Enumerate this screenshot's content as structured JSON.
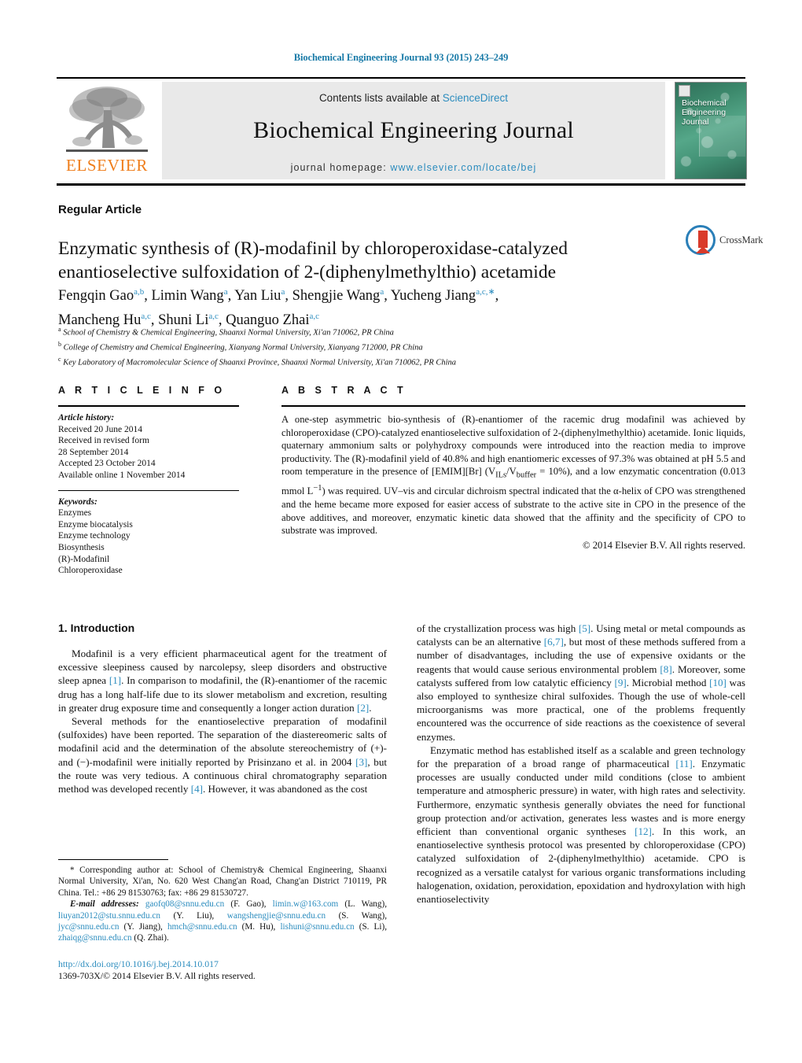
{
  "running_head": "Biochemical Engineering Journal 93 (2015) 243–249",
  "masthead": {
    "contents_prefix": "Contents lists available at ",
    "contents_link": "ScienceDirect",
    "journal_title": "Biochemical Engineering Journal",
    "homepage_label": "journal homepage:",
    "homepage_url": "www.elsevier.com/locate/bej",
    "publisher": "ELSEVIER",
    "cover_title_lines": [
      "Biochemical",
      "Engineering",
      "Journal"
    ],
    "link_color": "#2b8cbe",
    "publisher_color": "#ef7d1a"
  },
  "article": {
    "kind": "Regular Article",
    "title_line1": "Enzymatic synthesis of (R)-modafinil by chloroperoxidase-catalyzed",
    "title_line2": "enantioselective sulfoxidation of 2-(diphenylmethylthio) acetamide",
    "crossmark_label": "CrossMark",
    "authors_line1": "Fengqin Gao<sup>a,b</sup>, Limin Wang<sup>a</sup>, Yan Liu<sup>a</sup>, Shengjie Wang<sup>a</sup>, Yucheng Jiang<sup>a,c,∗</sup>,",
    "authors_line2": "Mancheng Hu<sup>a,c</sup>, Shuni Li<sup>a,c</sup>, Quanguo Zhai<sup>a,c</sup>",
    "affiliations": [
      "<sup>a</sup> School of Chemistry &amp; Chemical Engineering, Shaanxi Normal University, Xi'an 710062, PR China",
      "<sup>b</sup> College of Chemistry and Chemical Engineering, Xianyang Normal University, Xianyang 712000, PR China",
      "<sup>c</sup> Key Laboratory of Macromolecular Science of Shaanxi Province, Shaanxi Normal University, Xi'an 710062, PR China"
    ]
  },
  "article_info": {
    "heading": "A R T I C L E   I N F O",
    "history_label": "Article history:",
    "history": [
      "Received 20 June 2014",
      "Received in revised form",
      "28 September 2014",
      "Accepted 23 October 2014",
      "Available online 1 November 2014"
    ],
    "keywords_label": "Keywords:",
    "keywords": [
      "Enzymes",
      "Enzyme biocatalysis",
      "Enzyme technology",
      "Biosynthesis",
      "(R)-Modafinil",
      "Chloroperoxidase"
    ]
  },
  "abstract": {
    "heading": "A B S T R A C T",
    "text": "A one-step asymmetric bio-synthesis of (R)-enantiomer of the racemic drug modafinil was achieved by chloroperoxidase (CPO)-catalyzed enantioselective sulfoxidation of 2-(diphenylmethylthio) acetamide. Ionic liquids, quaternary ammonium salts or polyhydroxy compounds were introduced into the reaction media to improve productivity. The (R)-modafinil yield of 40.8% and high enantiomeric excesses of 97.3% was obtained at pH 5.5 and room temperature in the presence of [EMIM][Br] (V<sub>ILs</sub>/V<sub>buffer</sub> = 10%), and a low enzymatic concentration (0.013 mmol L<sup>−1</sup>) was required. UV–vis and circular dichroism spectral indicated that the α-helix of CPO was strengthened and the heme became more exposed for easier access of substrate to the active site in CPO in the presence of the above additives, and moreover, enzymatic kinetic data showed that the affinity and the specificity of CPO to substrate was improved.",
    "copyright": "© 2014 Elsevier B.V. All rights reserved."
  },
  "body": {
    "section_heading": "1. Introduction",
    "left_paragraphs": [
      "Modafinil is a very efficient pharmaceutical agent for the treatment of excessive sleepiness caused by narcolepsy, sleep disorders and obstructive sleep apnea <span class=\"ref\">[1]</span>. In comparison to modafinil, the (R)-enantiomer of the racemic drug has a long half-life due to its slower metabolism and excretion, resulting in greater drug exposure time and consequently a longer action duration <span class=\"ref\">[2]</span>.",
      "Several methods for the enantioselective preparation of modafinil (sulfoxides) have been reported. The separation of the diastereomeric salts of modafinil acid and the determination of the absolute stereochemistry of (+)- and (−)-modafinil were initially reported by Prisinzano et al. in 2004 <span class=\"ref\">[3]</span>, but the route was very tedious. A continuous chiral chromatography separation method was developed recently <span class=\"ref\">[4]</span>. However, it was abandoned as the cost"
    ],
    "right_paragraphs": [
      "of the crystallization process was high <span class=\"ref\">[5]</span>. Using metal or metal compounds as catalysts can be an alternative <span class=\"ref\">[6,7]</span>, but most of these methods suffered from a number of disadvantages, including the use of expensive oxidants or the reagents that would cause serious environmental problem <span class=\"ref\">[8]</span>. Moreover, some catalysts suffered from low catalytic efficiency <span class=\"ref\">[9]</span>. Microbial method <span class=\"ref\">[10]</span> was also employed to synthesize chiral sulfoxides. Though the use of whole-cell microorganisms was more practical, one of the problems frequently encountered was the occurrence of side reactions as the coexistence of several enzymes.",
      "Enzymatic method has established itself as a scalable and green technology for the preparation of a broad range of pharmaceutical <span class=\"ref\">[11]</span>. Enzymatic processes are usually conducted under mild conditions (close to ambient temperature and atmospheric pressure) in water, with high rates and selectivity. Furthermore, enzymatic synthesis generally obviates the need for functional group protection and/or activation, generates less wastes and is more energy efficient than conventional organic syntheses <span class=\"ref\">[12]</span>. In this work, an enantioselective synthesis protocol was presented by chloroperoxidase (CPO) catalyzed sulfoxidation of 2-(diphenylmethylthio) acetamide. CPO is recognized as a versatile catalyst for various organic transformations including halogenation, oxidation, peroxidation, epoxidation and hydroxylation with high enantioselectivity"
    ]
  },
  "footnotes": {
    "corresponding": "* Corresponding author at: School of Chemistry&amp; Chemical Engineering, Shaanxi Normal University, Xi'an, No. 620 West Chang'an Road, Chang'an District 710119, PR China. Tel.: +86 29 81530763; fax: +86 29 81530727.",
    "emails_label": "E-mail addresses:",
    "emails": "<span class=\"eml\">gaofq08@snnu.edu.cn</span> (F. Gao), <span class=\"eml\">limin.w@163.com</span> (L. Wang), <span class=\"eml\">liuyan2012@stu.snnu.edu.cn</span> (Y. Liu), <span class=\"eml\">wangshengjie@snnu.edu.cn</span> (S. Wang), <span class=\"eml\">jyc@snnu.edu.cn</span> (Y. Jiang), <span class=\"eml\">hmch@snnu.edu.cn</span> (M. Hu), <span class=\"eml\">lishuni@snnu.edu.cn</span> (S. Li), <span class=\"eml\">zhaiqg@snnu.edu.cn</span> (Q. Zhai)."
  },
  "bottom": {
    "doi": "http://dx.doi.org/10.1016/j.bej.2014.10.017",
    "issn": "1369-703X/© 2014 Elsevier B.V. All rights reserved."
  }
}
